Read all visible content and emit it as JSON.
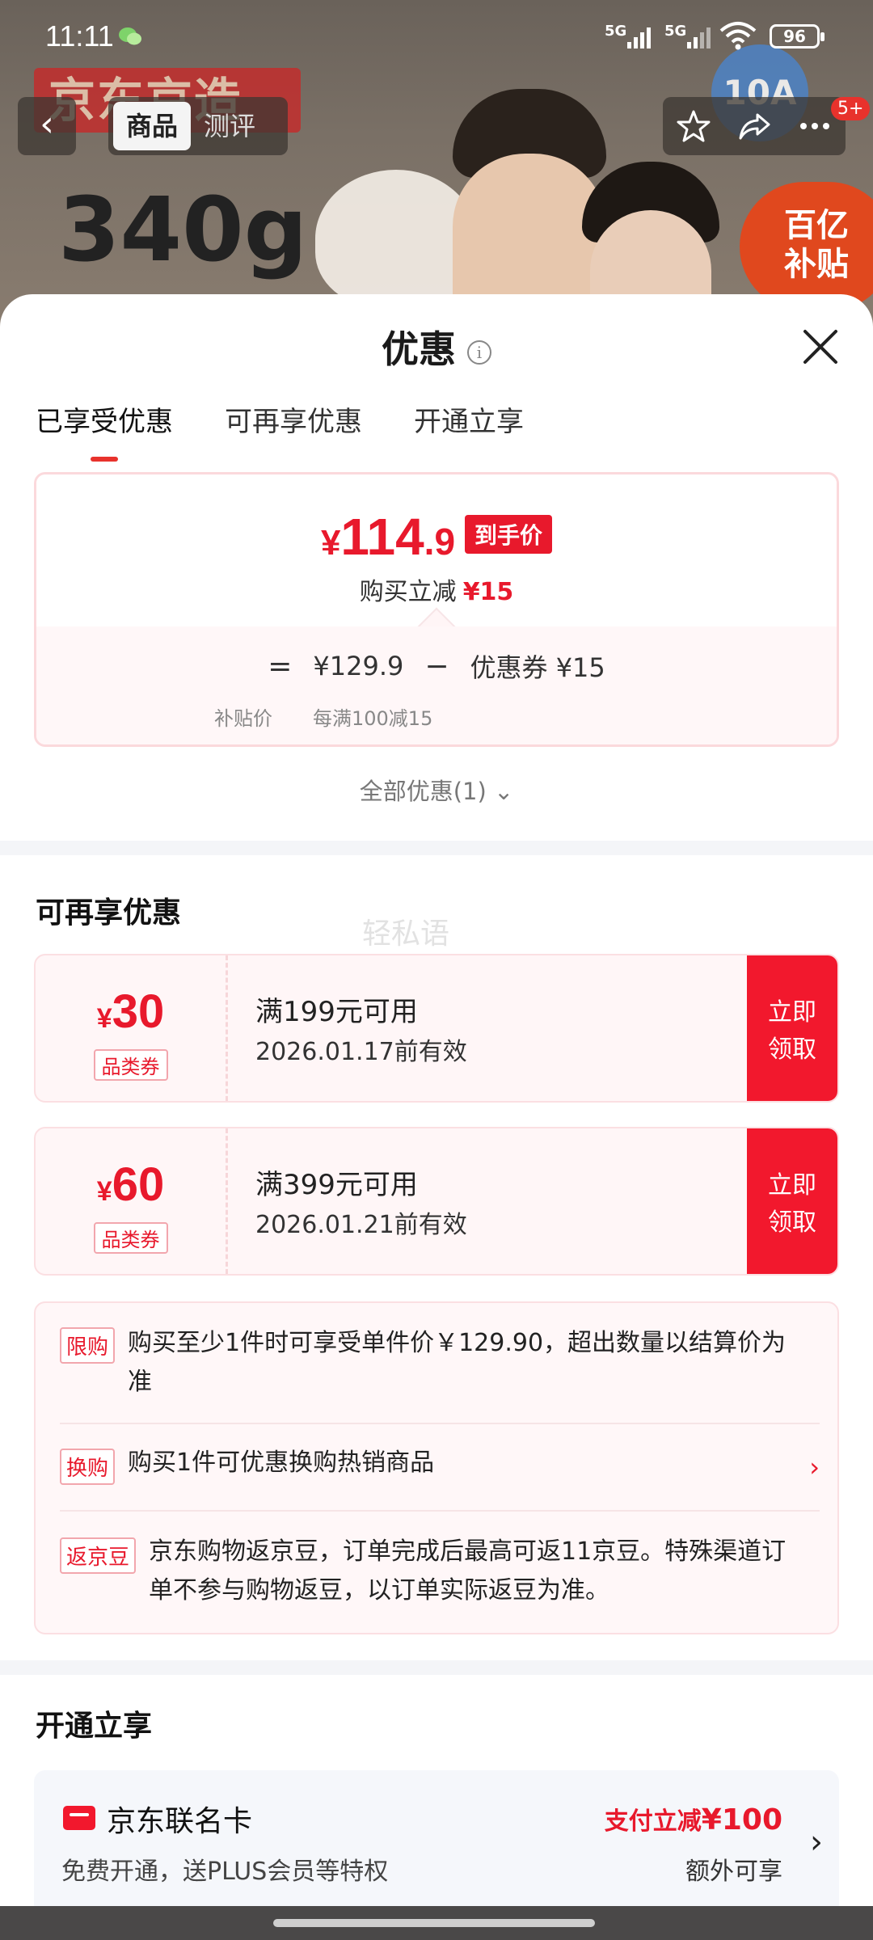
{
  "status_bar": {
    "time": "11:11",
    "signal1": "5G",
    "signal2": "5G",
    "battery": "96"
  },
  "background": {
    "banner_text": "京东京造",
    "weight_text": "340g",
    "subsidy_text_1": "百亿",
    "subsidy_text_2": "补贴",
    "badge_text": "10A"
  },
  "nav": {
    "back_icon": "chevron-left",
    "tabs": [
      "商品",
      "测评"
    ],
    "cart_count": "5+"
  },
  "sheet": {
    "title": "优惠",
    "tabs": [
      "已享受优惠",
      "可再享优惠",
      "开通立享"
    ],
    "summary": {
      "currency": "¥",
      "price_int": "114",
      "price_dec": ".9",
      "price_tag": "到手价",
      "reduce_label": "购买立减",
      "reduce_amount": "¥15",
      "eq": "=",
      "base_price": "¥129.9",
      "minus": "−",
      "coupon_label": "优惠券 ¥15",
      "base_caption": "补贴价",
      "coupon_caption": "每满100减15"
    },
    "all_offers": "全部优惠(1)",
    "more_title": "可再享优惠",
    "watermark": "轻私语",
    "coupons": [
      {
        "amount": "30",
        "tag": "品类券",
        "condition": "满199元可用",
        "date": "2026.01.17前有效",
        "button_line1": "立即",
        "button_line2": "领取"
      },
      {
        "amount": "60",
        "tag": "品类券",
        "condition": "满399元可用",
        "date": "2026.01.21前有效",
        "button_line1": "立即",
        "button_line2": "领取"
      }
    ],
    "rules": [
      {
        "tag": "限购",
        "text_line1": "购买至少1件时可享受单件价￥129.90，超出数量以结算价为",
        "text_line2": "准"
      },
      {
        "tag": "换购",
        "text_line1": "购买1件可优惠换购热销商品"
      },
      {
        "tag": "返京豆",
        "text_line1": "京东购物返京豆，订单完成后最高可返11京豆。特殊渠道订",
        "text_line2": "单不参与购物返豆，以订单实际返豆为准。"
      }
    ],
    "open_title": "开通立享",
    "card": {
      "name": "京东联名卡",
      "desc": "免费开通，送PLUS会员等特权",
      "promo_prefix": "支付立减",
      "promo_amount": "¥100",
      "extra": "额外可享"
    }
  },
  "colors": {
    "accent": "#e8192c",
    "sheet_bg": "#ffffff",
    "coupon_bg": "#fff6f7"
  }
}
